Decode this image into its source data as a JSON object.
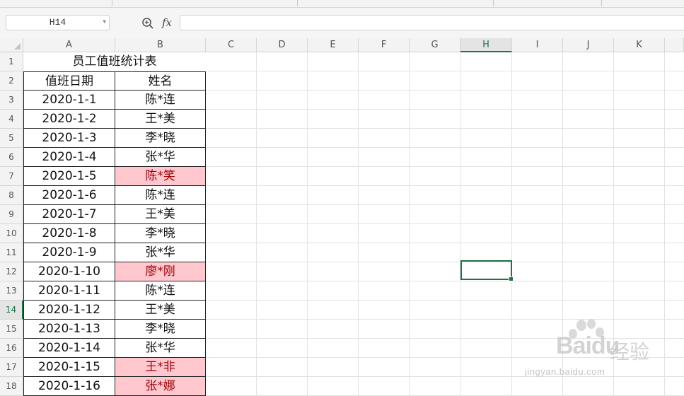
{
  "name_box": "H14",
  "formula_value": "",
  "icons": {
    "zoom": "zoom-icon",
    "fx": "fx"
  },
  "columns": [
    "A",
    "B",
    "C",
    "D",
    "E",
    "F",
    "G",
    "H",
    "I",
    "J",
    "K"
  ],
  "selected_column": "H",
  "rows": [
    "1",
    "2",
    "3",
    "4",
    "5",
    "6",
    "7",
    "8",
    "9",
    "10",
    "11",
    "12",
    "13",
    "14",
    "15",
    "16",
    "17",
    "18"
  ],
  "selected_row": "14",
  "table": {
    "title": "员工值班统计表",
    "header": {
      "date": "值班日期",
      "name": "姓名"
    },
    "records": [
      {
        "date": "2020-1-1",
        "name": "陈*连",
        "highlight": false
      },
      {
        "date": "2020-1-2",
        "name": "王*美",
        "highlight": false
      },
      {
        "date": "2020-1-3",
        "name": "李*晓",
        "highlight": false
      },
      {
        "date": "2020-1-4",
        "name": "张*华",
        "highlight": false
      },
      {
        "date": "2020-1-5",
        "name": "陈*笑",
        "highlight": true
      },
      {
        "date": "2020-1-6",
        "name": "陈*连",
        "highlight": false
      },
      {
        "date": "2020-1-7",
        "name": "王*美",
        "highlight": false
      },
      {
        "date": "2020-1-8",
        "name": "李*晓",
        "highlight": false
      },
      {
        "date": "2020-1-9",
        "name": "张*华",
        "highlight": false
      },
      {
        "date": "2020-1-10",
        "name": "廖*刚",
        "highlight": true
      },
      {
        "date": "2020-1-11",
        "name": "陈*连",
        "highlight": false
      },
      {
        "date": "2020-1-12",
        "name": "王*美",
        "highlight": false
      },
      {
        "date": "2020-1-13",
        "name": "李*晓",
        "highlight": false
      },
      {
        "date": "2020-1-14",
        "name": "张*华",
        "highlight": false
      },
      {
        "date": "2020-1-15",
        "name": "王*非",
        "highlight": true
      },
      {
        "date": "2020-1-16",
        "name": "张*娜",
        "highlight": true
      }
    ]
  },
  "colors": {
    "accent": "#217346",
    "highlight_fill": "#ffc7ce",
    "highlight_text": "#9c0006"
  },
  "watermark": {
    "brand": "Bai",
    "brand2": "du",
    "cn": "经验",
    "url": "jingyan.baidu.com"
  }
}
